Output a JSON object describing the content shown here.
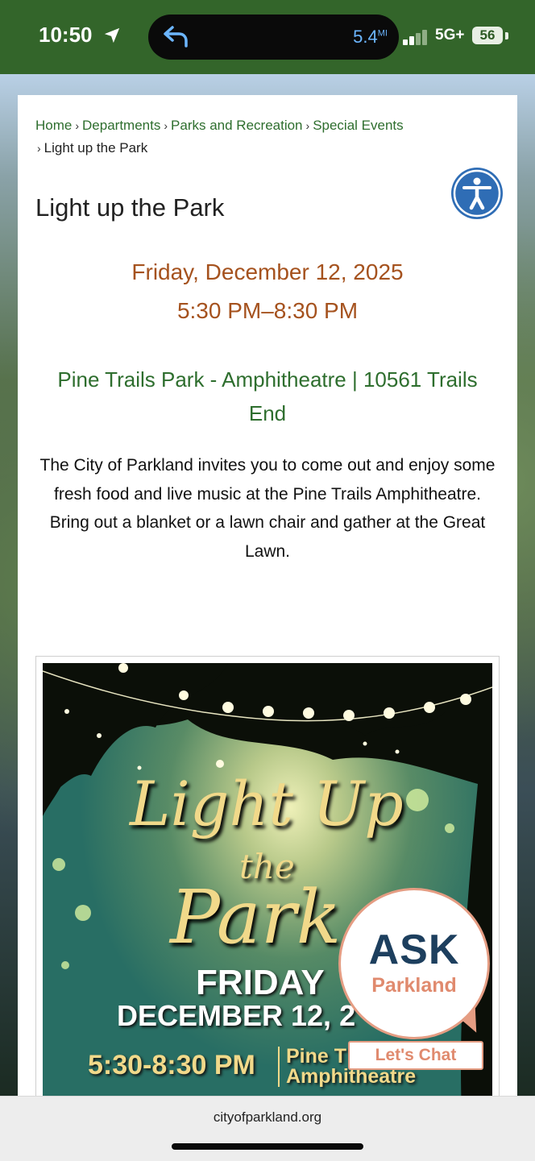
{
  "status_bar": {
    "time": "10:50",
    "speed": "5.4",
    "speed_unit": "MI",
    "network": "5G+",
    "battery": "56"
  },
  "breadcrumb": {
    "items": [
      "Home",
      "Departments",
      "Parks and Recreation",
      "Special Events"
    ],
    "current": "Light up the Park"
  },
  "page": {
    "title": "Light up the Park",
    "date": "Friday, December 12, 2025",
    "time": "5:30 PM–8:30 PM",
    "location": "Pine Trails Park - Amphitheatre | 10561 Trails End",
    "description_line1": "The City of Parkland invites you to come out and enjoy some fresh food and live music at the Pine Trails Amphitheatre.",
    "description_line2": "Bring out a blanket or a lawn chair and gather at the Great Lawn."
  },
  "poster": {
    "script_line1": "Light Up",
    "script_line2": "the",
    "script_line3": "Park",
    "day": "FRIDAY",
    "date": "DECEMBER 12, 2",
    "time": "5:30-8:30 PM",
    "venue_line1": "Pine T",
    "venue_line2": "Amphitheatre"
  },
  "chat_widget": {
    "title": "ASK",
    "subtitle": "Parkland",
    "button_label": "Let's Chat"
  },
  "browser": {
    "url": "cityofparkland.org"
  },
  "colors": {
    "status_bar_bg": "#33652a",
    "link_green": "#2e6e2e",
    "date_orange": "#a5521e",
    "accessibility_blue": "#2f6db5",
    "ask_navy": "#1d3f5e",
    "ask_coral": "#e08a6e"
  }
}
